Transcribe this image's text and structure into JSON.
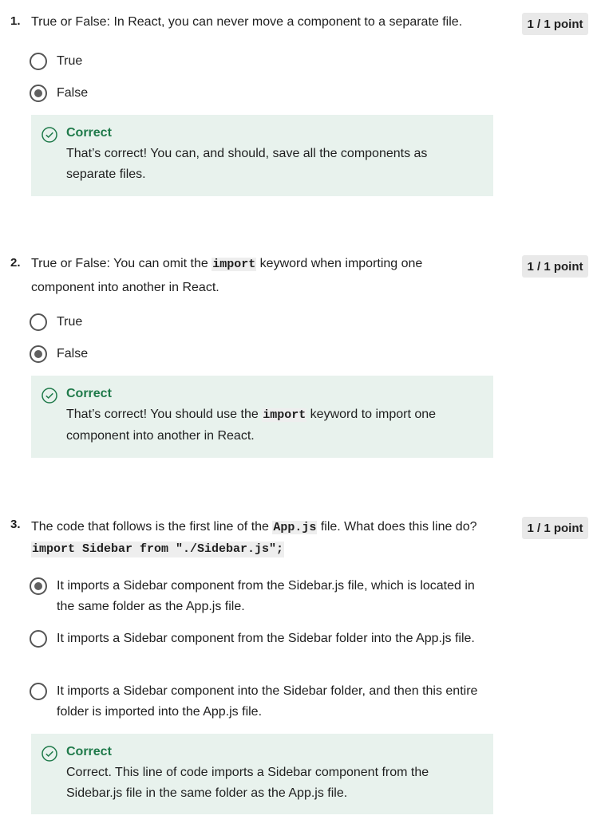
{
  "questions": [
    {
      "number": "1.",
      "points": "1 / 1 point",
      "text": "True or False: In React, you can never move a component to a separate file.",
      "options": [
        {
          "label": "True",
          "selected": false
        },
        {
          "label": "False",
          "selected": true
        }
      ],
      "feedback": {
        "title": "Correct",
        "text": "That’s correct! You can, and should, save all the components as separate files."
      }
    },
    {
      "number": "2.",
      "points": "1 / 1 point",
      "text_before": "True or False: You can omit the ",
      "text_code": "import",
      "text_after": " keyword when importing one component into another in React.",
      "options": [
        {
          "label": "True",
          "selected": false
        },
        {
          "label": "False",
          "selected": true
        }
      ],
      "feedback": {
        "title": "Correct",
        "text_before": "That’s correct! You should use the ",
        "text_code": "import",
        "text_after": " keyword to import one component into another in React."
      }
    },
    {
      "number": "3.",
      "points": "1 / 1 point",
      "text_before": "The code that follows is the first line of the ",
      "text_code": "App.js",
      "text_after": " file. What does this line do?",
      "code_line": "import Sidebar from \"./Sidebar.js\";",
      "options": [
        {
          "label": "It imports a Sidebar component from the Sidebar.js file, which is located in the same folder as the App.js file.",
          "selected": true
        },
        {
          "label": "It imports a Sidebar component from the Sidebar folder into the App.js file.",
          "selected": false
        },
        {
          "label": "It imports a Sidebar component into the Sidebar folder, and then this entire folder is imported into the App.js file.",
          "selected": false
        }
      ],
      "feedback": {
        "title": "Correct",
        "text": "Correct. This line of code imports a Sidebar component from the Sidebar.js file in the same folder as the App.js file."
      }
    }
  ],
  "colors": {
    "correct": "#1f7a4a",
    "feedback_bg": "#e8f2ed",
    "badge_bg": "#e9e9e9"
  },
  "icons": {
    "feedback": "check-circle-icon"
  }
}
